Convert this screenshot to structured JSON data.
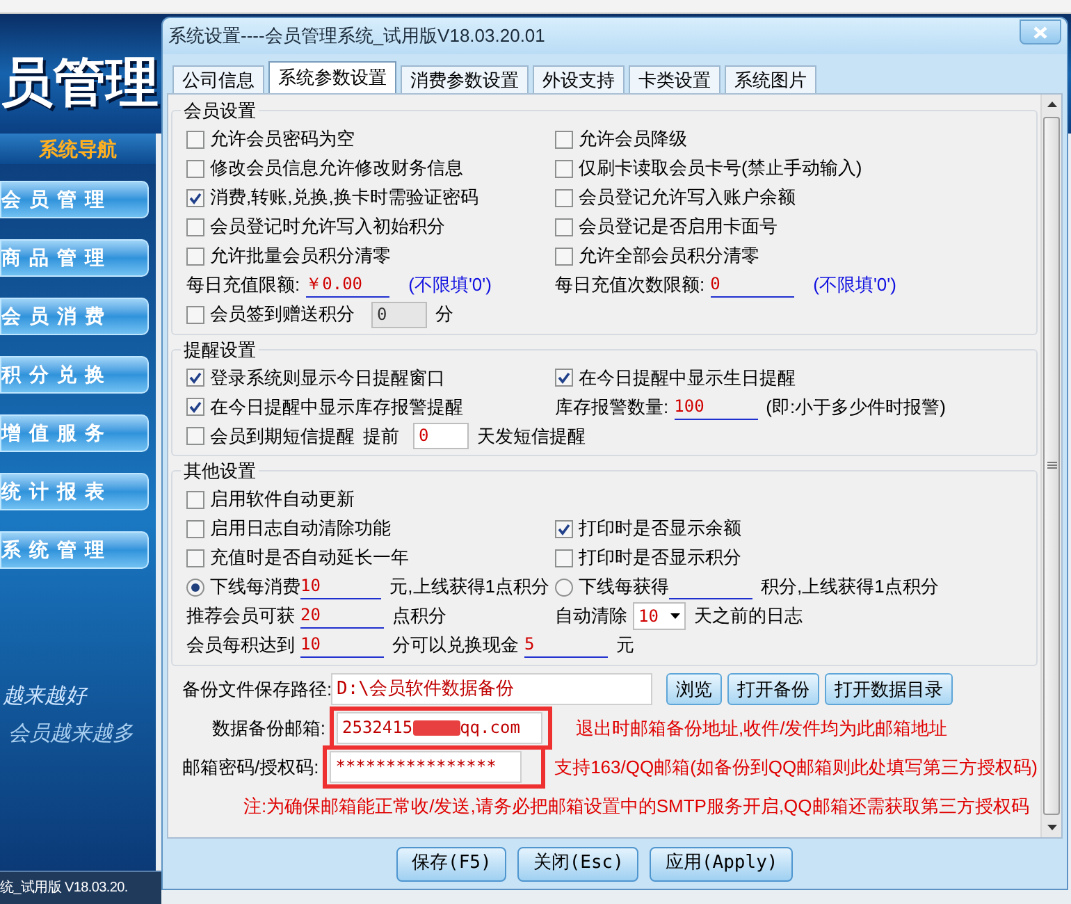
{
  "app": {
    "header_title": "员管理",
    "nav_title": "系统导航",
    "nav_items": [
      {
        "label": "会员管理"
      },
      {
        "label": "商品管理"
      },
      {
        "label": "会员消费"
      },
      {
        "label": "积分兑换"
      },
      {
        "label": "增值服务"
      },
      {
        "label": "统计报表"
      },
      {
        "label": "系统管理"
      }
    ],
    "slogans": [
      "越来越好",
      "会员越来越多"
    ],
    "status_text": "统_试用版 V18.03.20."
  },
  "dialog": {
    "title": "系统设置----会员管理系统_试用版V18.03.20.01",
    "tabs": [
      {
        "label": "公司信息",
        "selected": false
      },
      {
        "label": "系统参数设置",
        "selected": true
      },
      {
        "label": "消费参数设置",
        "selected": false
      },
      {
        "label": "外设支持",
        "selected": false
      },
      {
        "label": "卡类设置",
        "selected": false
      },
      {
        "label": "系统图片",
        "selected": false
      }
    ],
    "groups": [
      {
        "legend": "会员设置",
        "rows": [
          {
            "left": [
              {
                "kind": "checkbox",
                "label": "允许会员密码为空",
                "checked": false
              }
            ],
            "right": [
              {
                "kind": "checkbox",
                "label": "允许会员降级",
                "checked": false
              }
            ]
          },
          {
            "left": [
              {
                "kind": "checkbox",
                "label": "修改会员信息允许修改财务信息",
                "checked": false
              }
            ],
            "right": [
              {
                "kind": "checkbox",
                "label": "仅刷卡读取会员卡号(禁止手动输入)",
                "checked": false
              }
            ]
          },
          {
            "left": [
              {
                "kind": "checkbox",
                "label": "消费,转账,兑换,换卡时需验证密码",
                "checked": true
              }
            ],
            "right": [
              {
                "kind": "checkbox",
                "label": "会员登记允许写入账户余额",
                "checked": false
              }
            ]
          },
          {
            "left": [
              {
                "kind": "checkbox",
                "label": "会员登记时允许写入初始积分",
                "checked": false
              }
            ],
            "right": [
              {
                "kind": "checkbox",
                "label": "会员登记是否启用卡面号",
                "checked": false
              }
            ]
          },
          {
            "left": [
              {
                "kind": "checkbox",
                "label": "允许批量会员积分清零",
                "checked": false
              }
            ],
            "right": [
              {
                "kind": "checkbox",
                "label": "允许全部会员积分清零",
                "checked": false
              }
            ]
          },
          {
            "left": [
              {
                "kind": "label",
                "text": "每日充值限额:"
              },
              {
                "kind": "underline",
                "value": "￥0.00"
              },
              {
                "kind": "hint",
                "text": "(不限填'0')"
              }
            ],
            "right": [
              {
                "kind": "label",
                "text": "每日充值次数限额:"
              },
              {
                "kind": "underline",
                "value": "0"
              },
              {
                "kind": "hint",
                "text": "(不限填'0')"
              }
            ]
          },
          {
            "left": [
              {
                "kind": "checkbox",
                "label": "会员签到赠送积分",
                "checked": false
              },
              {
                "kind": "box",
                "value": "0",
                "disabled": true
              },
              {
                "kind": "label",
                "text": "分"
              }
            ]
          }
        ]
      },
      {
        "legend": "提醒设置",
        "rows": [
          {
            "left": [
              {
                "kind": "checkbox",
                "label": "登录系统则显示今日提醒窗口",
                "checked": true
              }
            ],
            "right": [
              {
                "kind": "checkbox",
                "label": "在今日提醒中显示生日提醒",
                "checked": true
              }
            ]
          },
          {
            "left": [
              {
                "kind": "checkbox",
                "label": "在今日提醒中显示库存报警提醒",
                "checked": true
              }
            ],
            "right": [
              {
                "kind": "label",
                "text": "库存报警数量:"
              },
              {
                "kind": "underline",
                "value": "100"
              },
              {
                "kind": "label",
                "text": "(即:小于多少件时报警)"
              }
            ]
          },
          {
            "left": [
              {
                "kind": "checkbox",
                "label": "会员到期短信提醒",
                "checked": false
              },
              {
                "kind": "label",
                "text": "提前"
              },
              {
                "kind": "box",
                "value": "0",
                "disabled": false
              },
              {
                "kind": "label",
                "text": "天发短信提醒"
              }
            ]
          }
        ]
      },
      {
        "legend": "其他设置",
        "rows": [
          {
            "left": [
              {
                "kind": "checkbox",
                "label": "启用软件自动更新",
                "checked": false
              }
            ]
          },
          {
            "left": [
              {
                "kind": "checkbox",
                "label": "启用日志自动清除功能",
                "checked": false
              }
            ],
            "right": [
              {
                "kind": "checkbox",
                "label": "打印时是否显示余额",
                "checked": true
              }
            ]
          },
          {
            "left": [
              {
                "kind": "checkbox",
                "label": "充值时是否自动延长一年",
                "checked": false
              }
            ],
            "right": [
              {
                "kind": "checkbox",
                "label": "打印时是否显示积分",
                "checked": false
              }
            ]
          },
          {
            "left": [
              {
                "kind": "radio",
                "label": "下线每消费",
                "selected": true
              },
              {
                "kind": "underline",
                "value": "10"
              },
              {
                "kind": "label",
                "text": "元,上线获得1点积分"
              }
            ],
            "right": [
              {
                "kind": "radio",
                "label": "下线每获得",
                "selected": false
              },
              {
                "kind": "underline"
              },
              {
                "kind": "label",
                "text": "积分,上线获得1点积分"
              }
            ]
          },
          {
            "left": [
              {
                "kind": "label",
                "text": "推荐会员可获"
              },
              {
                "kind": "underline",
                "value": "20"
              },
              {
                "kind": "label",
                "text": "点积分"
              }
            ],
            "right": [
              {
                "kind": "label",
                "text": "自动清除"
              },
              {
                "kind": "select",
                "value": "10"
              },
              {
                "kind": "label",
                "text": "天之前的日志"
              }
            ]
          },
          {
            "left": [
              {
                "kind": "label",
                "text": "会员每积达到"
              },
              {
                "kind": "underline",
                "value": "10"
              },
              {
                "kind": "label",
                "text": "分可以兑换现金"
              },
              {
                "kind": "underline",
                "value": "5"
              },
              {
                "kind": "label",
                "text": "元"
              }
            ]
          }
        ]
      }
    ],
    "backup": {
      "path_label": "备份文件保存路径:",
      "path_value": "D:\\会员软件数据备份",
      "path_buttons": [
        "浏览",
        "打开备份",
        "打开数据目录"
      ],
      "email_label": "数据备份邮箱:",
      "email_start": "2532415",
      "email_end": "qq.com",
      "email_note": "退出时邮箱备份地址,收件/发件均为此邮箱地址",
      "password_label": "邮箱密码/授权码:",
      "password_value": "****************",
      "password_note": "支持163/QQ邮箱(如备份到QQ邮箱则此处填写第三方授权码)",
      "footer_note": "注:为确保邮箱能正常收/发送,请务必把邮箱设置中的SMTP服务开启,QQ邮箱还需获取第三方授权码"
    },
    "buttons": [
      "保存(F5)",
      "关闭(Esc)",
      "应用(Apply)"
    ]
  }
}
